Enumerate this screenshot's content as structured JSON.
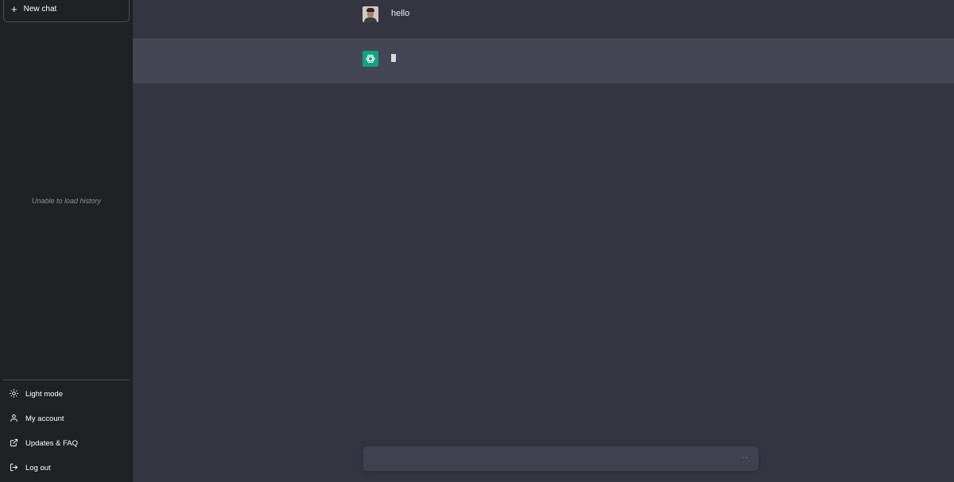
{
  "sidebar": {
    "new_chat_label": "New chat",
    "history_message": "Unable to load history",
    "items": [
      {
        "label": "Light mode",
        "icon": "sun-icon"
      },
      {
        "label": "My account",
        "icon": "user-icon"
      },
      {
        "label": "Updates & FAQ",
        "icon": "external-link-icon"
      },
      {
        "label": "Log out",
        "icon": "logout-icon"
      }
    ]
  },
  "conversation": {
    "messages": [
      {
        "role": "user",
        "text": "hello",
        "avatar": "user-avatar"
      },
      {
        "role": "assistant",
        "text": "",
        "avatar": "openai-logo-icon"
      }
    ]
  },
  "composer": {
    "value": "",
    "loading_indicator": "··"
  },
  "colors": {
    "sidebar_bg": "#202123",
    "main_bg": "#343541",
    "assistant_row_bg": "#444654",
    "bot_avatar": "#10a37f",
    "input_bg": "#40414f"
  }
}
